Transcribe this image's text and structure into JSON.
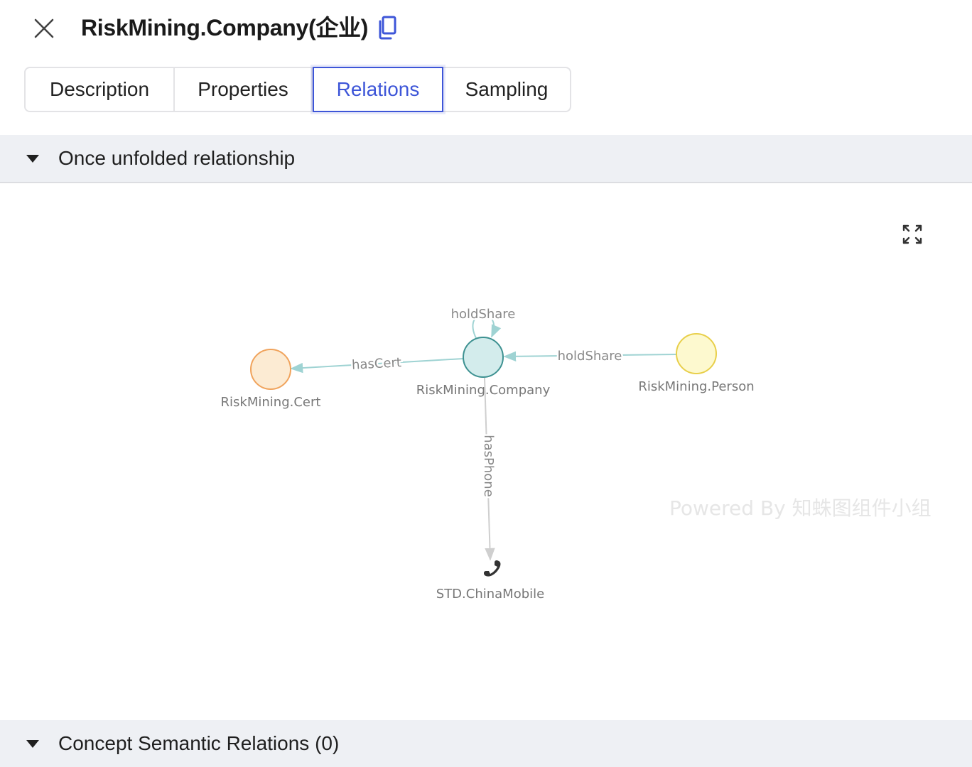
{
  "header": {
    "title": "RiskMining.Company(企业)",
    "close_icon": "close-icon",
    "copy_icon": "copy-icon"
  },
  "tabs": [
    {
      "label": "Description",
      "active": false
    },
    {
      "label": "Properties",
      "active": false
    },
    {
      "label": "Relations",
      "active": true
    },
    {
      "label": "Sampling",
      "active": false
    }
  ],
  "sections": {
    "once_unfolded": "Once unfolded relationship",
    "concept_semantic": "Concept Semantic Relations (0)"
  },
  "graph": {
    "fullscreen_icon": "fullscreen-icon",
    "watermark": "Powered By 知蛛图组件小组",
    "nodes": {
      "company": "RiskMining.Company",
      "cert": "RiskMining.Cert",
      "person": "RiskMining.Person",
      "mobile": "STD.ChinaMobile"
    },
    "edges": {
      "self_hold": "holdShare",
      "has_cert": "hasCert",
      "hold_share": "holdShare",
      "has_phone": "hasPhone"
    },
    "colors": {
      "accent": "#3e56d8",
      "company_fill": "#d3ecec",
      "company_stroke": "#3d9191",
      "cert_fill": "#fcebd3",
      "cert_stroke": "#f0a35c",
      "person_fill": "#fdf9cf",
      "person_stroke": "#e8cf4a",
      "edge": "#9fd3d3",
      "edge_gray": "#cfcfcf"
    }
  }
}
